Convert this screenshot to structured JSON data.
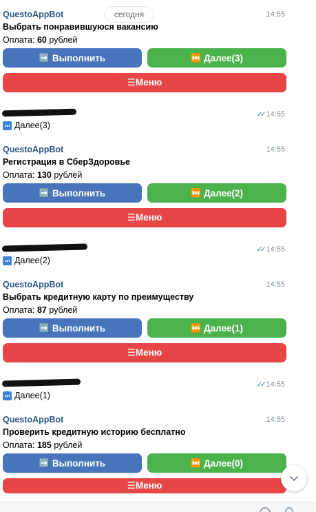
{
  "date_pill": "сегодня",
  "messages": [
    {
      "sender": "QuestoAppBot",
      "time": "14:55",
      "title": "Выбрать понравившуюся вакансию",
      "pay_label": "Оплата:",
      "pay_amount": "60",
      "pay_unit": "рублей",
      "exec_label": "Выполнить",
      "next_label": "Далее(3)",
      "menu_label": "☰Меню"
    },
    {
      "sender": "QuestoAppBot",
      "time": "14:55",
      "title": "Регистрация в СберЗдоровье",
      "pay_label": "Оплата:",
      "pay_amount": "130",
      "pay_unit": "рублей",
      "exec_label": "Выполнить",
      "next_label": "Далее(2)",
      "menu_label": "☰Меню"
    },
    {
      "sender": "QuestoAppBot",
      "time": "14:55",
      "title": "Выбрать кредитную карту по преимуществу",
      "pay_label": "Оплата:",
      "pay_amount": "87",
      "pay_unit": "рублей",
      "exec_label": "Выполнить",
      "next_label": "Далее(1)",
      "menu_label": "☰Меню"
    },
    {
      "sender": "QuestoAppBot",
      "time": "14:55",
      "title": "Проверить кредитную историю бесплатно",
      "pay_label": "Оплата:",
      "pay_amount": "185",
      "pay_unit": "рублей",
      "exec_label": "Выполнить",
      "next_label": "Далее(0)",
      "menu_label": "☰Меню"
    }
  ],
  "user_replies": [
    {
      "text": "Далее(3)",
      "time": "14:55"
    },
    {
      "text": "Далее(2)",
      "time": "14:55"
    },
    {
      "text": "Далее(1)",
      "time": "14:55"
    }
  ],
  "icons": {
    "exec": "right-arrow-emoji",
    "next": "next-track-emoji",
    "read": "double-check-icon",
    "scroll": "chevron-down-icon"
  },
  "colors": {
    "sender": "#2a5885",
    "exec_button": "#4774ba",
    "next_button": "#4cb34c",
    "menu_button": "#e64646",
    "time": "#818c99"
  }
}
